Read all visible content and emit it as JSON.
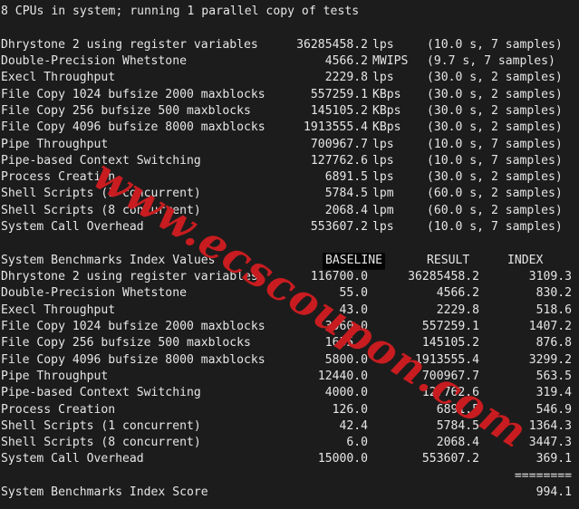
{
  "terminal": {
    "background_color": "#1c1c1c",
    "text_color": "#e6e6e6",
    "header_line": "8 CPUs in system; running 1 parallel copy of tests",
    "benchmark_results": [
      {
        "label": "Dhrystone 2 using register variables",
        "value": "36285458.2",
        "unit": "lps",
        "samples": "(10.0 s, 7 samples)"
      },
      {
        "label": "Double-Precision Whetstone",
        "value": "4566.2",
        "unit": "MWIPS",
        "samples": "(9.7 s, 7 samples)"
      },
      {
        "label": "Execl Throughput",
        "value": "2229.8",
        "unit": "lps",
        "samples": "(30.0 s, 2 samples)"
      },
      {
        "label": "File Copy 1024 bufsize 2000 maxblocks",
        "value": "557259.1",
        "unit": "KBps",
        "samples": "(30.0 s, 2 samples)"
      },
      {
        "label": "File Copy 256 bufsize 500 maxblocks",
        "value": "145105.2",
        "unit": "KBps",
        "samples": "(30.0 s, 2 samples)"
      },
      {
        "label": "File Copy 4096 bufsize 8000 maxblocks",
        "value": "1913555.4",
        "unit": "KBps",
        "samples": "(30.0 s, 2 samples)"
      },
      {
        "label": "Pipe Throughput",
        "value": "700967.7",
        "unit": "lps",
        "samples": "(10.0 s, 7 samples)"
      },
      {
        "label": "Pipe-based Context Switching",
        "value": "127762.6",
        "unit": "lps",
        "samples": "(10.0 s, 7 samples)"
      },
      {
        "label": "Process Creation",
        "value": "6891.5",
        "unit": "lps",
        "samples": "(30.0 s, 2 samples)"
      },
      {
        "label": "Shell Scripts (1 concurrent)",
        "value": "5784.5",
        "unit": "lpm",
        "samples": "(60.0 s, 2 samples)"
      },
      {
        "label": "Shell Scripts (8 concurrent)",
        "value": "2068.4",
        "unit": "lpm",
        "samples": "(60.0 s, 2 samples)"
      },
      {
        "label": "System Call Overhead",
        "value": "553607.2",
        "unit": "lps",
        "samples": "(10.0 s, 7 samples)"
      }
    ],
    "index_table": {
      "title": "System Benchmarks Index Values",
      "headers": {
        "baseline": "BASELINE",
        "result": "RESULT",
        "index": "INDEX"
      },
      "rows": [
        {
          "label": "Dhrystone 2 using register variables",
          "baseline": "116700.0",
          "result": "36285458.2",
          "index": "3109.3"
        },
        {
          "label": "Double-Precision Whetstone",
          "baseline": "55.0",
          "result": "4566.2",
          "index": "830.2"
        },
        {
          "label": "Execl Throughput",
          "baseline": "43.0",
          "result": "2229.8",
          "index": "518.6"
        },
        {
          "label": "File Copy 1024 bufsize 2000 maxblocks",
          "baseline": "3960.0",
          "result": "557259.1",
          "index": "1407.2"
        },
        {
          "label": "File Copy 256 bufsize 500 maxblocks",
          "baseline": "1655.0",
          "result": "145105.2",
          "index": "876.8"
        },
        {
          "label": "File Copy 4096 bufsize 8000 maxblocks",
          "baseline": "5800.0",
          "result": "1913555.4",
          "index": "3299.2"
        },
        {
          "label": "Pipe Throughput",
          "baseline": "12440.0",
          "result": "700967.7",
          "index": "563.5"
        },
        {
          "label": "Pipe-based Context Switching",
          "baseline": "4000.0",
          "result": "127762.6",
          "index": "319.4"
        },
        {
          "label": "Process Creation",
          "baseline": "126.0",
          "result": "6891.5",
          "index": "546.9"
        },
        {
          "label": "Shell Scripts (1 concurrent)",
          "baseline": "42.4",
          "result": "5784.5",
          "index": "1364.3"
        },
        {
          "label": "Shell Scripts (8 concurrent)",
          "baseline": "6.0",
          "result": "2068.4",
          "index": "3447.3"
        },
        {
          "label": "System Call Overhead",
          "baseline": "15000.0",
          "result": "553607.2",
          "index": "369.1"
        }
      ],
      "separator": "========",
      "score_label": "System Benchmarks Index Score",
      "score_value": "994.1"
    },
    "watermark": {
      "text": "www.ecscoupon.com",
      "color": "#c81c20"
    }
  }
}
